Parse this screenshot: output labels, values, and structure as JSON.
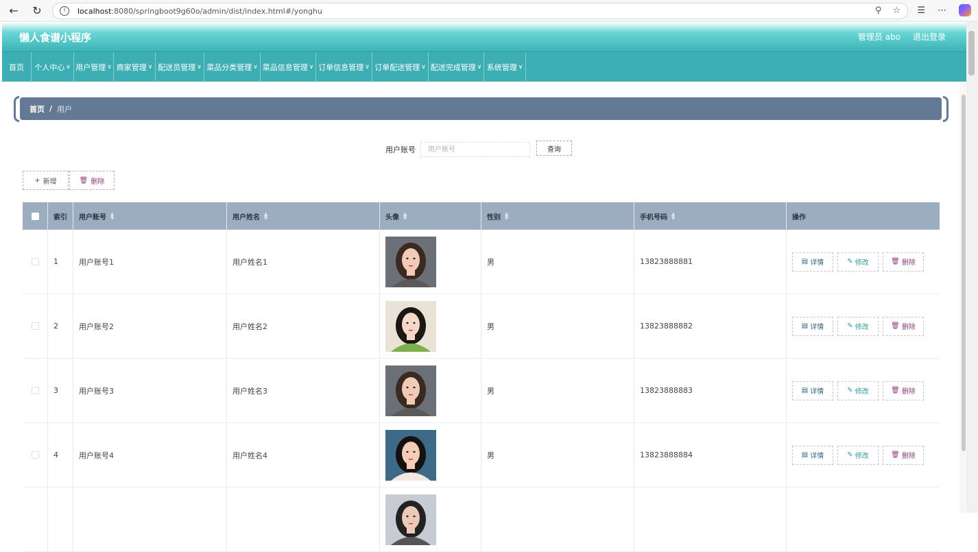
{
  "browser": {
    "url_host": "localhost",
    "url_rest": ":8080/springboot9g60o/admin/dist/index.html#/yonghu",
    "back_icon": "arrow-left-icon",
    "reload_icon": "reload-icon"
  },
  "header": {
    "title": "懒人食谱小程序",
    "user": "管理员 abo",
    "logout": "退出登录"
  },
  "menu": [
    {
      "label": "首页",
      "dropdown": false
    },
    {
      "label": "个人中心",
      "dropdown": true
    },
    {
      "label": "用户管理",
      "dropdown": true
    },
    {
      "label": "商家管理",
      "dropdown": true
    },
    {
      "label": "配送员管理",
      "dropdown": true
    },
    {
      "label": "菜品分类管理",
      "dropdown": true
    },
    {
      "label": "菜品信息管理",
      "dropdown": true
    },
    {
      "label": "订单信息管理",
      "dropdown": true
    },
    {
      "label": "订单配送管理",
      "dropdown": true
    },
    {
      "label": "配送完成管理",
      "dropdown": true
    },
    {
      "label": "系统管理",
      "dropdown": true
    }
  ],
  "breadcrumb": {
    "home": "首页",
    "separator": "/",
    "current": "用户"
  },
  "search": {
    "label": "用户账号",
    "placeholder": "用户账号",
    "button": "查询"
  },
  "actions": {
    "add": "新增",
    "delete": "删除"
  },
  "table": {
    "headers": {
      "index": "索引",
      "account": "用户账号",
      "name": "用户姓名",
      "avatar": "头像",
      "gender": "性别",
      "phone": "手机号码",
      "ops": "操作"
    },
    "op_labels": {
      "detail": "详情",
      "edit": "修改",
      "remove": "删除"
    },
    "rows": [
      {
        "index": "1",
        "account": "用户账号1",
        "name": "用户姓名1",
        "gender": "男",
        "phone": "13823888881"
      },
      {
        "index": "2",
        "account": "用户账号2",
        "name": "用户姓名2",
        "gender": "男",
        "phone": "13823888882"
      },
      {
        "index": "3",
        "account": "用户账号3",
        "name": "用户姓名3",
        "gender": "男",
        "phone": "13823888883"
      },
      {
        "index": "4",
        "account": "用户账号4",
        "name": "用户姓名4",
        "gender": "男",
        "phone": "13823888884"
      },
      {
        "index": "",
        "account": "",
        "name": "",
        "gender": "",
        "phone": ""
      }
    ]
  },
  "colors": {
    "header_teal": "#3cb3b6",
    "menu_teal": "#3eaeb5",
    "breadcrumb": "#647a94",
    "table_header": "#9cadc0",
    "delete_purple": "#8e3d7c"
  }
}
